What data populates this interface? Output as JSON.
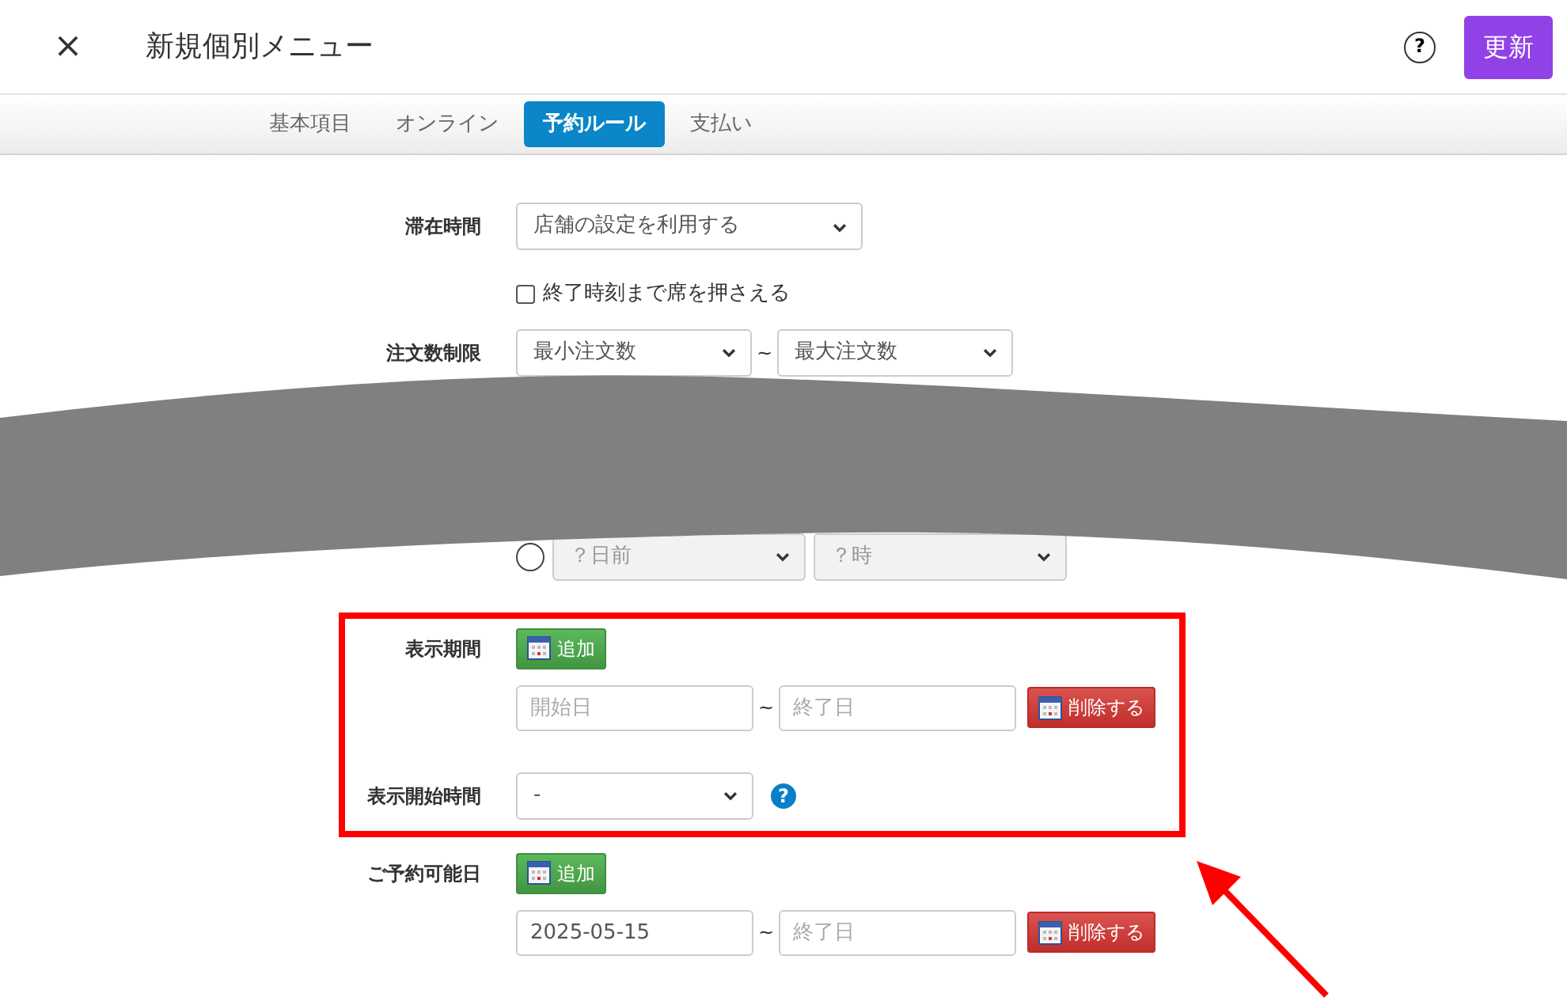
{
  "header": {
    "close": "×",
    "title": "新規個別メニュー",
    "help": "?",
    "update_button": "更新"
  },
  "tabs": [
    {
      "label": "基本項目",
      "selected": false
    },
    {
      "label": "オンライン",
      "selected": false
    },
    {
      "label": "予約ルール",
      "selected": true
    },
    {
      "label": "支払い",
      "selected": false
    }
  ],
  "rows": [
    {
      "kind": "select",
      "label": "滞在時間",
      "value": "店舗の設定を利用する"
    },
    {
      "kind": "checkbox",
      "text": "終了時刻まで席を押さえる",
      "checked": false
    },
    {
      "kind": "range_select",
      "label": "注文数制限",
      "from": "最小注文数",
      "separator": "~",
      "to": "最大注文数"
    },
    {
      "kind": "cut"
    },
    {
      "kind": "radio_select",
      "selected": false,
      "disabled": true,
      "selects": [
        "？日前",
        "？時"
      ]
    },
    {
      "kind": "date_range",
      "label": "表示期間",
      "highlighted": true,
      "add_button": "追加",
      "start": {
        "placeholder": "開始日"
      },
      "separator": "~",
      "end": {
        "placeholder": "終了日"
      },
      "delete_button": "削除する"
    },
    {
      "kind": "select_help",
      "label": "表示開始時間",
      "highlighted": true,
      "value": "-",
      "help": "?"
    },
    {
      "kind": "date_range",
      "label": "ご予約可能日",
      "highlighted": false,
      "add_button": "追加",
      "start": {
        "value": "2025-05-15"
      },
      "separator": "~",
      "end": {
        "placeholder": "終了日"
      },
      "delete_button": "削除する"
    }
  ],
  "annotation_arrow": true
}
